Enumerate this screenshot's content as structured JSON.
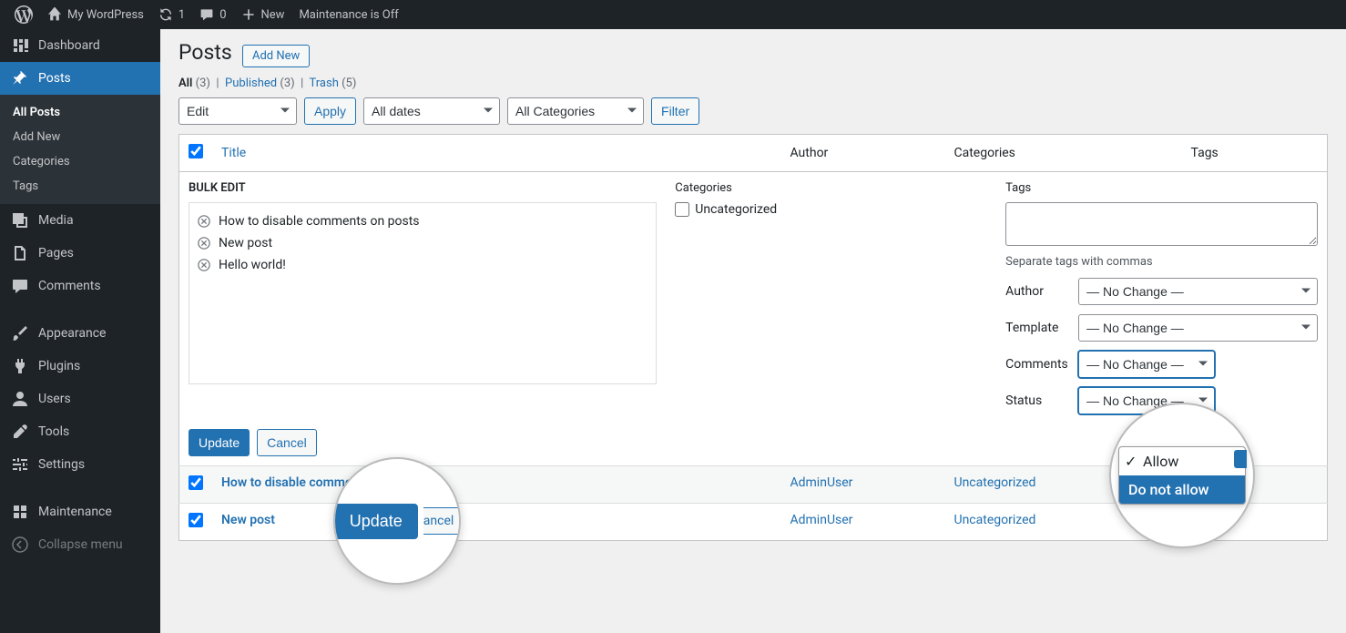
{
  "adminbar": {
    "site_name": "My WordPress",
    "updates": "1",
    "comments": "0",
    "new_label": "New",
    "maintenance": "Maintenance is Off"
  },
  "sidebar": {
    "dashboard": "Dashboard",
    "posts": "Posts",
    "posts_sub": {
      "all": "All Posts",
      "add": "Add New",
      "categories": "Categories",
      "tags": "Tags"
    },
    "media": "Media",
    "pages": "Pages",
    "comments": "Comments",
    "appearance": "Appearance",
    "plugins": "Plugins",
    "users": "Users",
    "tools": "Tools",
    "settings": "Settings",
    "maintenance": "Maintenance",
    "collapse": "Collapse menu"
  },
  "page": {
    "heading": "Posts",
    "add_new": "Add New",
    "filters": {
      "all_label": "All",
      "all_count": "(3)",
      "published_label": "Published",
      "published_count": "(3)",
      "trash_label": "Trash",
      "trash_count": "(5)"
    },
    "bulk_select": "Edit",
    "apply": "Apply",
    "dates": "All dates",
    "cats": "All Categories",
    "filter_btn": "Filter",
    "columns": {
      "title": "Title",
      "author": "Author",
      "categories": "Categories",
      "tags": "Tags"
    }
  },
  "bulk": {
    "heading": "BULK EDIT",
    "titles": [
      "How to disable comments on posts",
      "New post",
      "Hello world!"
    ],
    "cat_heading": "Categories",
    "cat_item": "Uncategorized",
    "tags_heading": "Tags",
    "tags_hint": "Separate tags with commas",
    "author_label": "Author",
    "template_label": "Template",
    "comments_label": "Comments",
    "status_label": "Status",
    "no_change": "— No Change —",
    "update": "Update",
    "cancel": "Cancel"
  },
  "rows": [
    {
      "title": "How to disable comments on posts",
      "author": "AdminUser",
      "category": "Uncategorized",
      "tags": "—"
    },
    {
      "title": "New post",
      "author": "AdminUser",
      "category": "Uncategorized",
      "tags": "—"
    }
  ],
  "magnifier": {
    "update": "Update",
    "cancel_partial": "ancel",
    "opt_allow": "Allow",
    "opt_deny": "Do not allow"
  }
}
